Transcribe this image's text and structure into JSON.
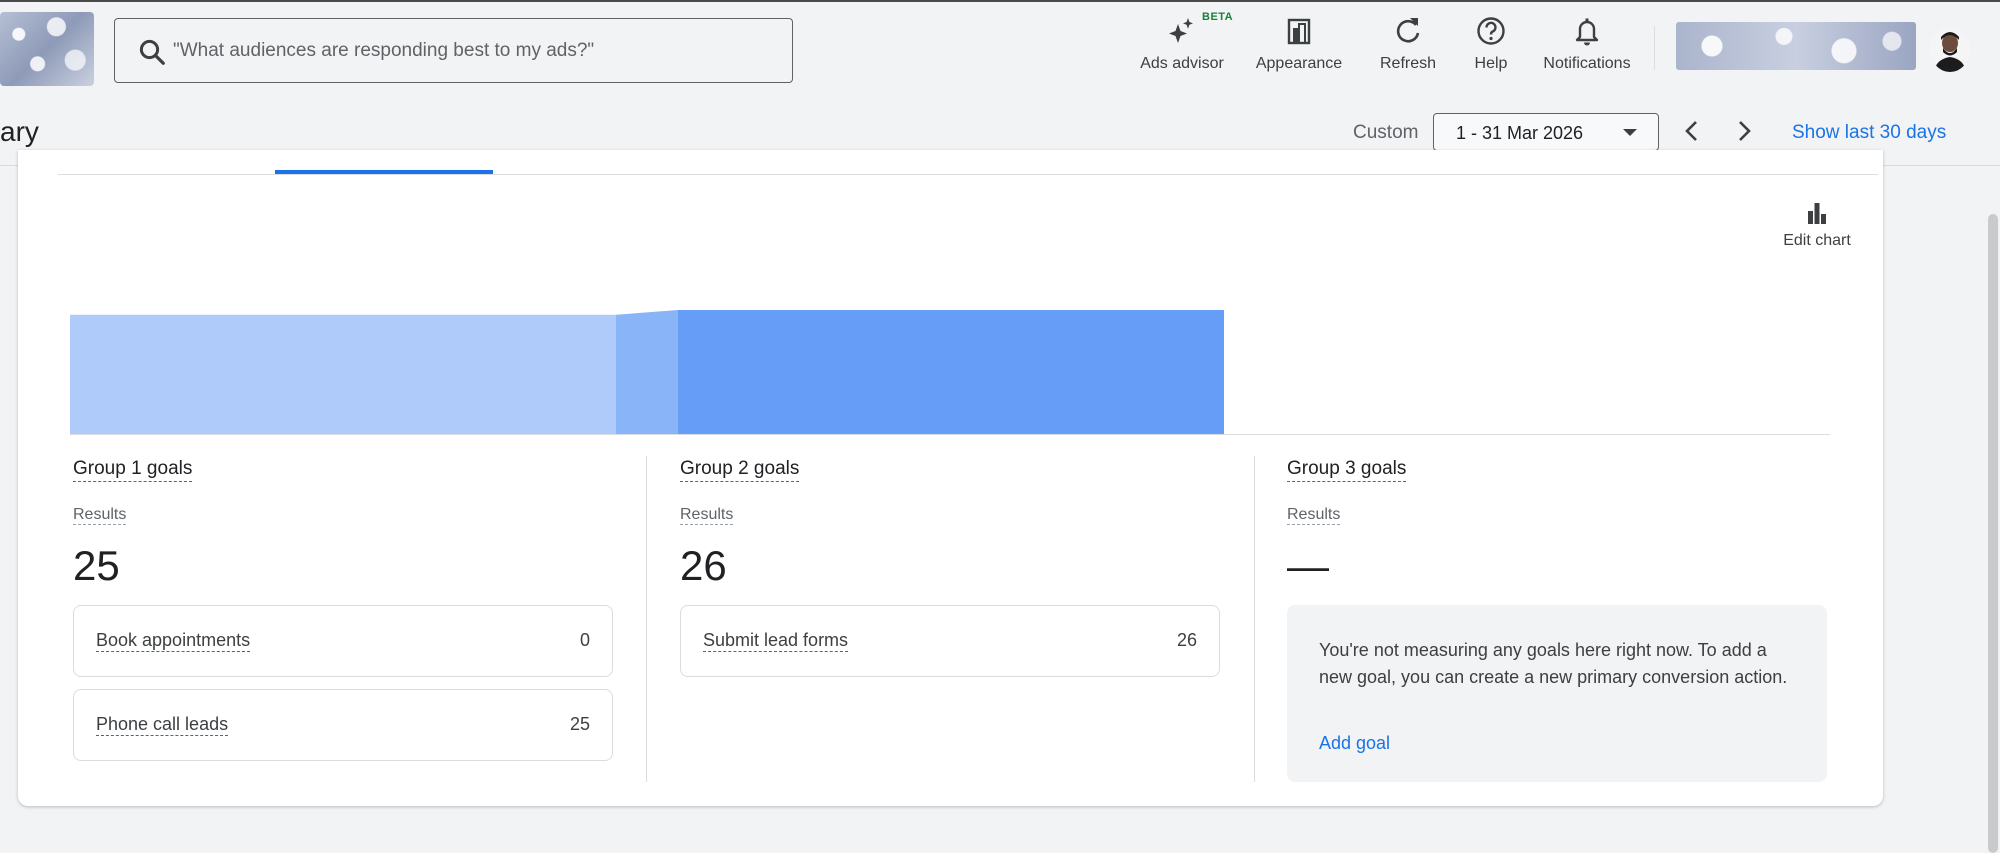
{
  "header": {
    "search": {
      "placeholder": "\"What audiences are responding best to my ads?\""
    },
    "tools": [
      {
        "label": "Ads advisor",
        "icon": "sparkle-icon",
        "badge": "BETA"
      },
      {
        "label": "Appearance",
        "icon": "appearance-icon"
      },
      {
        "label": "Refresh",
        "icon": "refresh-icon"
      },
      {
        "label": "Help",
        "icon": "help-icon"
      },
      {
        "label": "Notifications",
        "icon": "bell-icon"
      }
    ]
  },
  "subheader": {
    "page_title": "ary",
    "date_mode": "Custom",
    "date_range": "1 - 31 Mar 2026",
    "show_last": "Show last 30 days"
  },
  "card": {
    "edit_chart": "Edit chart",
    "funnel": {
      "colors": {
        "group1": "#aecbfa",
        "transition": "#8ab4f8",
        "group2": "#669df6"
      },
      "values": [
        25,
        26
      ]
    },
    "groups": [
      {
        "title": "Group 1 goals",
        "results_label": "Results",
        "results_value": "25",
        "goals": [
          {
            "name": "Book appointments",
            "count": "0"
          },
          {
            "name": "Phone call leads",
            "count": "25"
          }
        ]
      },
      {
        "title": "Group 2 goals",
        "results_label": "Results",
        "results_value": "26",
        "goals": [
          {
            "name": "Submit lead forms",
            "count": "26"
          }
        ]
      },
      {
        "title": "Group 3 goals",
        "results_label": "Results",
        "results_value": "—",
        "empty_message": "You're not measuring any goals here right now. To add a new goal, you can create a new primary conversion action.",
        "add_goal": "Add goal"
      }
    ]
  }
}
